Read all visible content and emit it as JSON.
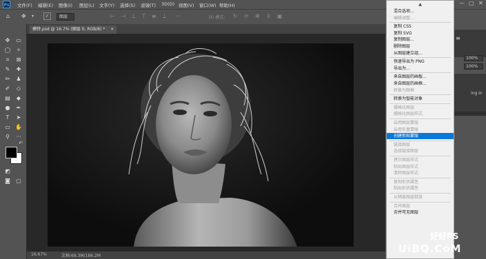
{
  "app": {
    "logo": "Ps"
  },
  "menubar": {
    "items": [
      "文件(F)",
      "编辑(E)",
      "图像(I)",
      "图层(L)",
      "文字(Y)",
      "选择(S)",
      "滤镜(T)",
      "3D(D)",
      "视图(V)",
      "窗口(W)",
      "帮助(H)"
    ],
    "window_controls": [
      "—",
      "▢",
      "✕"
    ]
  },
  "options_bar": {
    "auto_select_value": "图层",
    "mode_label": "3D 模式:"
  },
  "document": {
    "tab_label": "模特.psd @ 16.7% (图层 0, RGB/8) *",
    "tab_close": "×",
    "zoom": "16.67%",
    "doc_size": "文档:69.3M/186.2M"
  },
  "context_menu": {
    "scroll_up": "▲",
    "items": [
      {
        "label": "混合选项...",
        "enabled": true
      },
      {
        "label": "编辑调整...",
        "enabled": false
      },
      {
        "label": "复制 CSS",
        "enabled": true,
        "sep_before": true
      },
      {
        "label": "复制 SVG",
        "enabled": true
      },
      {
        "label": "复制图层...",
        "enabled": true
      },
      {
        "label": "删除图层",
        "enabled": true
      },
      {
        "label": "从图层建立组...",
        "enabled": true
      },
      {
        "label": "快速导出为 PNG",
        "enabled": true,
        "sep_before": true
      },
      {
        "label": "导出为...",
        "enabled": true
      },
      {
        "label": "来自图层的画板...",
        "enabled": true,
        "sep_before": true
      },
      {
        "label": "来自图层的画框...",
        "enabled": true
      },
      {
        "label": "转换为图框",
        "enabled": false
      },
      {
        "label": "转换为智能对象",
        "enabled": true,
        "sep_before": true
      },
      {
        "label": "栅格化图层",
        "enabled": false,
        "sep_before": true
      },
      {
        "label": "栅格化图层样式",
        "enabled": false
      },
      {
        "label": "启用图层蒙版",
        "enabled": false,
        "sep_before": true
      },
      {
        "label": "启用矢量蒙版",
        "enabled": false
      },
      {
        "label": "创建剪贴蒙版",
        "enabled": true,
        "selected": true
      },
      {
        "label": "链接图层",
        "enabled": false,
        "sep_before": true
      },
      {
        "label": "选择链接图层",
        "enabled": false
      },
      {
        "label": "拷贝图层样式",
        "enabled": false,
        "sep_before": true
      },
      {
        "label": "粘贴图层样式",
        "enabled": false
      },
      {
        "label": "清除图层样式",
        "enabled": false
      },
      {
        "label": "复制形状属性",
        "enabled": false,
        "sep_before": true
      },
      {
        "label": "粘贴形状属性",
        "enabled": false
      },
      {
        "label": "从隔离图层释放",
        "enabled": false,
        "sep_before": true
      },
      {
        "label": "合并图层",
        "enabled": false,
        "sep_before": true
      },
      {
        "label": "合并可见图层",
        "enabled": true
      }
    ]
  },
  "right_panel": {
    "opacity_label": "100%",
    "fill_label": "100%",
    "lock_hint": "ing in"
  },
  "watermark": {
    "brand": "好好PS",
    "site": "UiBQ.CoM"
  },
  "colors": {
    "selection": "#0a78d7",
    "accent": "#31a8ff"
  }
}
